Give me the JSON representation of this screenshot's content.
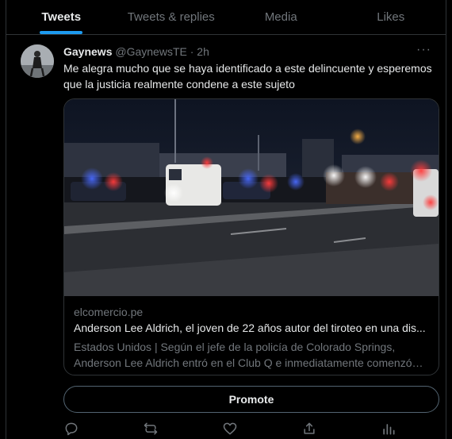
{
  "tabs": [
    {
      "label": "Tweets",
      "active": true
    },
    {
      "label": "Tweets & replies",
      "active": false
    },
    {
      "label": "Media",
      "active": false
    },
    {
      "label": "Likes",
      "active": false
    }
  ],
  "tweet": {
    "author_name": "Gaynews",
    "author_handle": "@GaynewsTE",
    "separator": "·",
    "time": "2h",
    "text": "Me alegra mucho que se haya identificado a este delincuente y esperemos que la justicia realmente condene a este sujeto",
    "more_icon": "more-dots-icon"
  },
  "card": {
    "domain": "elcomercio.pe",
    "title": "Anderson Lee Aldrich, el joven de 22 años autor del tiroteo en una dis...",
    "description": "Estados Unidos | Según el jefe de la policía de Colorado Springs, Anderson Lee Aldrich entró en el Club Q e inmediatamente comenzó a..."
  },
  "promote_label": "Promote",
  "actions": [
    "reply-icon",
    "retweet-icon",
    "like-icon",
    "share-icon",
    "analytics-icon"
  ],
  "colors": {
    "accent": "#1d9bf0",
    "background": "#000000",
    "border": "#2f3336",
    "muted": "#71767b"
  }
}
